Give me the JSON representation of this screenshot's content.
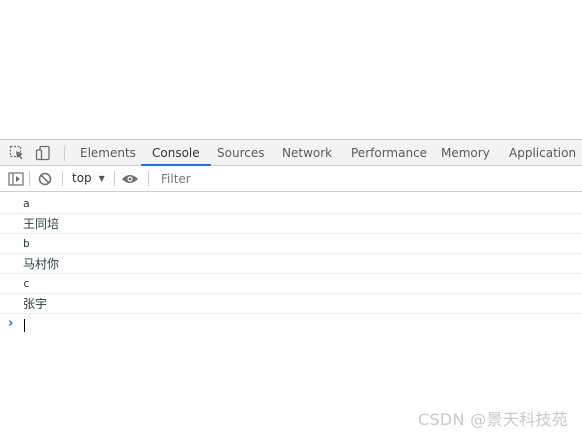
{
  "tabs": [
    "Elements",
    "Console",
    "Sources",
    "Network",
    "Performance",
    "Memory",
    "Application"
  ],
  "active_tab": "Console",
  "toolbar": {
    "context": "top",
    "filter_placeholder": "Filter"
  },
  "console": {
    "lines": [
      "a",
      "王同培",
      "b",
      "马村你",
      "c",
      "张宇"
    ]
  },
  "watermark": "CSDN @景天科技苑",
  "colors": {
    "accent": "#1a73e8",
    "tabbar_bg": "#f3f3f3",
    "border": "#cacdd1"
  }
}
